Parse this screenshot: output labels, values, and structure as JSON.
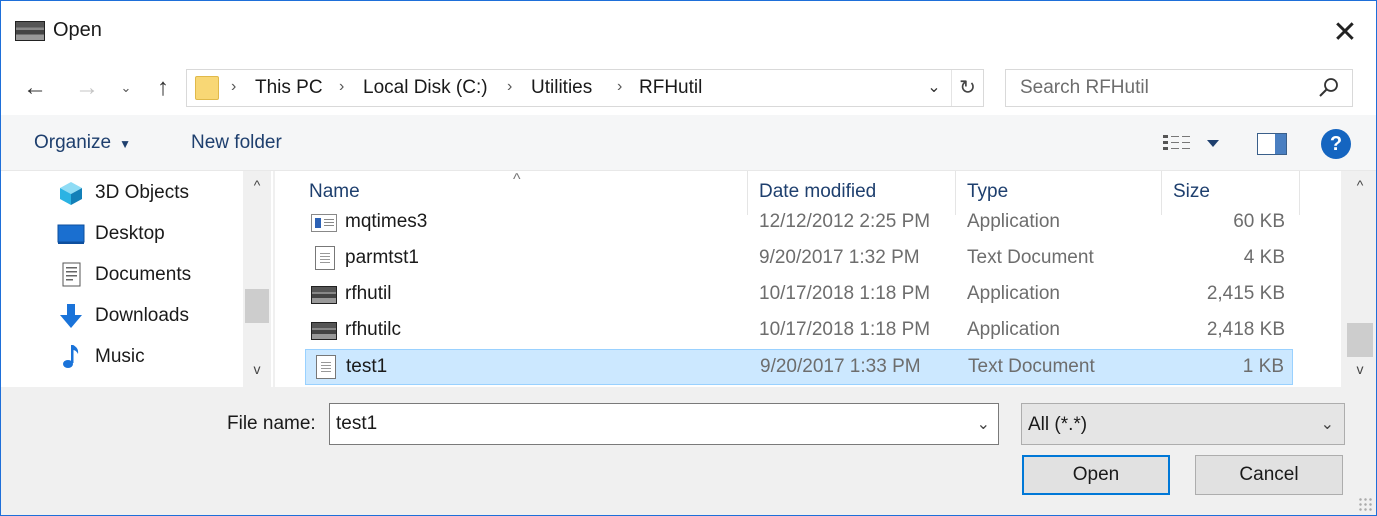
{
  "window": {
    "title": "Open",
    "close_glyph": "✕"
  },
  "nav": {
    "back_glyph": "←",
    "forward_glyph": "→",
    "recent_glyph": "⌄",
    "up_glyph": "↑",
    "breadcrumb": [
      "This PC",
      "Local Disk (C:)",
      "Utilities",
      "RFHutil"
    ],
    "breadcrumb_sep": "›",
    "dropdown_glyph": "⌄",
    "refresh_glyph": "↻"
  },
  "search": {
    "placeholder": "Search RFHutil",
    "value": ""
  },
  "toolbar": {
    "organize_label": "Organize",
    "organize_caret": "▼",
    "new_folder_label": "New folder",
    "help_glyph": "?"
  },
  "sidebar": {
    "items": [
      {
        "label": "3D Objects",
        "icon": "3d-objects-icon"
      },
      {
        "label": "Desktop",
        "icon": "desktop-icon"
      },
      {
        "label": "Documents",
        "icon": "documents-icon"
      },
      {
        "label": "Downloads",
        "icon": "downloads-icon"
      },
      {
        "label": "Music",
        "icon": "music-icon"
      }
    ],
    "scroll_up": "^",
    "scroll_down": "v"
  },
  "filelist": {
    "sort_caret": "^",
    "columns": {
      "name": "Name",
      "date": "Date modified",
      "type": "Type",
      "size": "Size"
    },
    "rows": [
      {
        "name": "mqtimes3",
        "date": "12/12/2012 2:25 PM",
        "type": "Application",
        "size": "60 KB",
        "icon": "application-window-icon"
      },
      {
        "name": "parmtst1",
        "date": "9/20/2017 1:32 PM",
        "type": "Text Document",
        "size": "4 KB",
        "icon": "text-document-icon"
      },
      {
        "name": "rfhutil",
        "date": "10/17/2018 1:18 PM",
        "type": "Application",
        "size": "2,415 KB",
        "icon": "rfhutil-app-icon"
      },
      {
        "name": "rfhutilc",
        "date": "10/17/2018 1:18 PM",
        "type": "Application",
        "size": "2,418 KB",
        "icon": "rfhutil-app-icon"
      },
      {
        "name": "test1",
        "date": "9/20/2017 1:33 PM",
        "type": "Text Document",
        "size": "1 KB",
        "icon": "text-document-icon",
        "selected": true
      }
    ],
    "scroll_up": "^",
    "scroll_down": "v"
  },
  "footer": {
    "file_name_label": "File name:",
    "file_name_value": "test1",
    "file_type_value": "All (*.*)",
    "dropdown_glyph": "⌄",
    "open_label": "Open",
    "cancel_label": "Cancel"
  },
  "colors": {
    "accent": "#0078d7",
    "selection_bg": "#cce8ff",
    "selection_border": "#99d1ff",
    "link_text": "#1e3f6e"
  }
}
